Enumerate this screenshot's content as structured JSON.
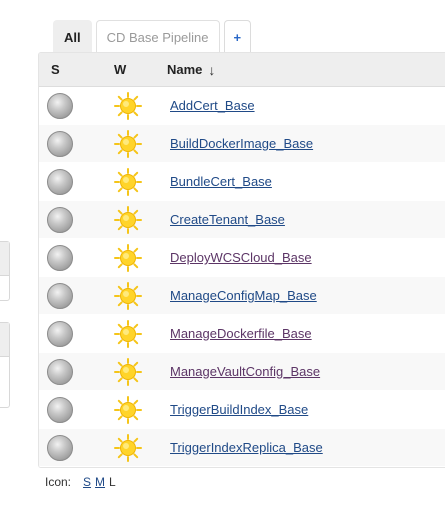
{
  "tabs": [
    {
      "label": "All",
      "active": true
    },
    {
      "label": "CD Base Pipeline",
      "active": false
    },
    {
      "label": "+",
      "active": false
    }
  ],
  "table": {
    "headers": {
      "status": "S",
      "weather": "W",
      "name": "Name",
      "sort_indicator": "↓"
    },
    "rows": [
      {
        "name": "AddCert_Base",
        "status_icon": "grey-ball-icon",
        "weather_icon": "sunny-weather-icon",
        "visited": false
      },
      {
        "name": "BuildDockerImage_Base",
        "status_icon": "grey-ball-icon",
        "weather_icon": "sunny-weather-icon",
        "visited": false
      },
      {
        "name": "BundleCert_Base",
        "status_icon": "grey-ball-icon",
        "weather_icon": "sunny-weather-icon",
        "visited": false
      },
      {
        "name": "CreateTenant_Base",
        "status_icon": "grey-ball-icon",
        "weather_icon": "sunny-weather-icon",
        "visited": false
      },
      {
        "name": "DeployWCSCloud_Base",
        "status_icon": "grey-ball-icon",
        "weather_icon": "sunny-weather-icon",
        "visited": true
      },
      {
        "name": "ManageConfigMap_Base",
        "status_icon": "grey-ball-icon",
        "weather_icon": "sunny-weather-icon",
        "visited": false
      },
      {
        "name": "ManageDockerfile_Base",
        "status_icon": "grey-ball-icon",
        "weather_icon": "sunny-weather-icon",
        "visited": true
      },
      {
        "name": "ManageVaultConfig_Base",
        "status_icon": "grey-ball-icon",
        "weather_icon": "sunny-weather-icon",
        "visited": true
      },
      {
        "name": "TriggerBuildIndex_Base",
        "status_icon": "grey-ball-icon",
        "weather_icon": "sunny-weather-icon",
        "visited": false
      },
      {
        "name": "TriggerIndexReplica_Base",
        "status_icon": "grey-ball-icon",
        "weather_icon": "sunny-weather-icon",
        "visited": false
      }
    ]
  },
  "icon_legend": {
    "label": "Icon:",
    "sizes": [
      {
        "label": "S",
        "link": true
      },
      {
        "label": "M",
        "link": true
      },
      {
        "label": "L",
        "link": false
      }
    ]
  },
  "colors": {
    "link": "#204a87",
    "visited_link": "#5c3566",
    "tab_active_bg": "#eeeeee",
    "add_tab": "#2a68c8"
  }
}
